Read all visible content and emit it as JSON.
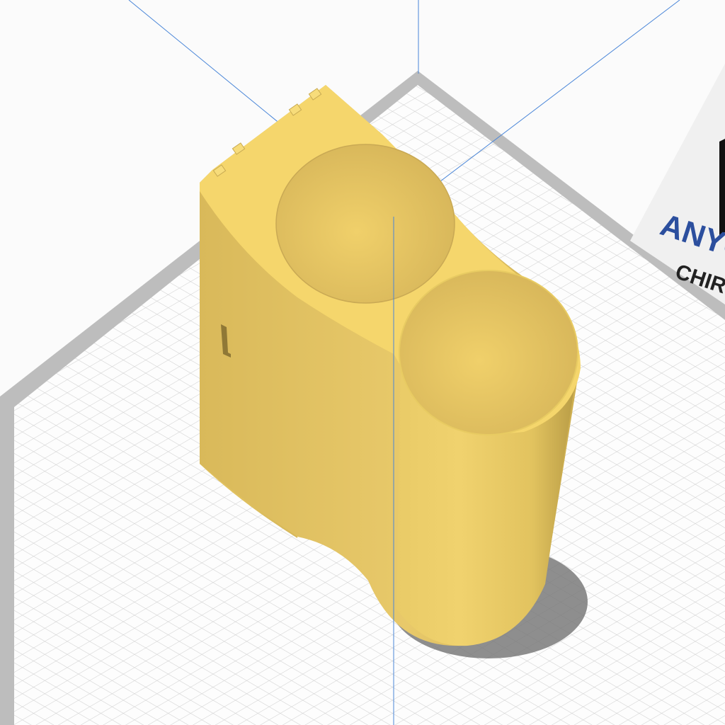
{
  "viewport": {
    "background": "#fbfbfb",
    "bed_color": "#bdbdbd",
    "bed_border_color": "#9a9a9a",
    "grid_line_color": "#d2d2d2",
    "axis_line_color": "#4a86d8",
    "model_color": "#f3d36a",
    "model_shadow_color": "#7f7f7f"
  },
  "printer_label": {
    "brand_line": "ANYC",
    "model_line": "CHIRO",
    "brand_color": "#2c4f9e",
    "model_color": "#222222",
    "logo_icon": "anycubic-logo-icon"
  },
  "model": {
    "name_icon": "dual-cylinder-holder-model"
  }
}
